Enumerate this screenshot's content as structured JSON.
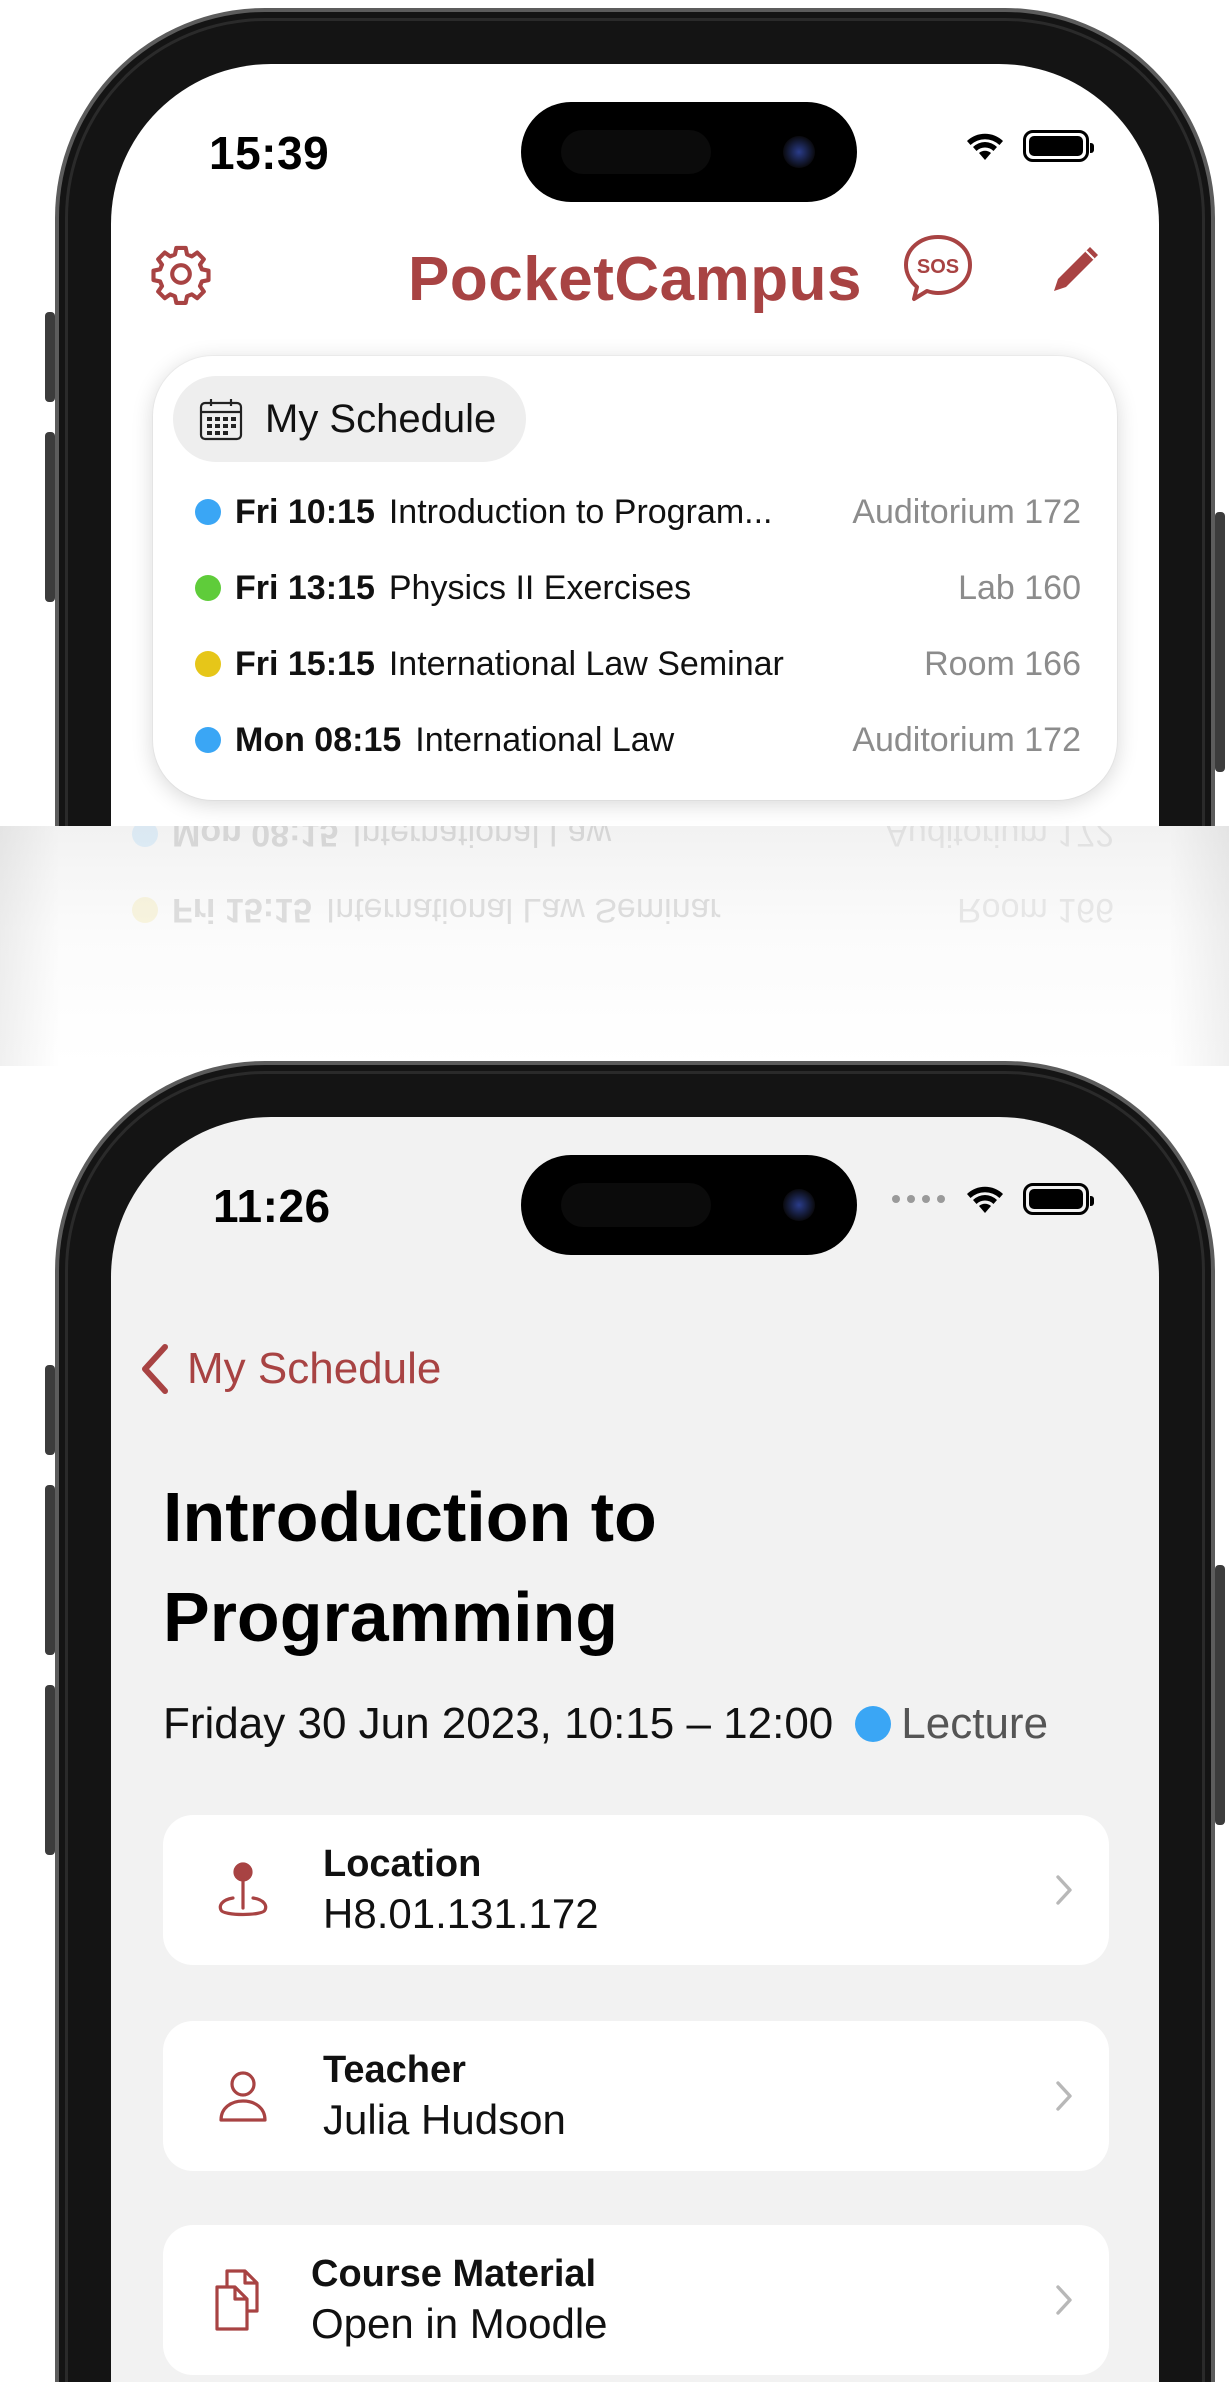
{
  "colors": {
    "brand": "#a84343",
    "lecture_blue": "#3aa6f5",
    "exercise_green": "#5fcc3a",
    "seminar_yellow": "#e6c619",
    "secondary_text": "#8c8c8c"
  },
  "phone1": {
    "status_time": "15:39",
    "app_title": "PocketCampus",
    "icons": [
      "gear-icon",
      "sos-icon",
      "pencil-icon"
    ],
    "widget": {
      "chip_label": "My Schedule",
      "chip_icon": "calendar-icon",
      "rows": [
        {
          "dot": "#3aa6f5",
          "when": "Fri 10:15",
          "title": "Introduction to Program...",
          "room": "Auditorium 172"
        },
        {
          "dot": "#5fcc3a",
          "when": "Fri 13:15",
          "title": "Physics II Exercises",
          "room": "Lab 160"
        },
        {
          "dot": "#e6c619",
          "when": "Fri 15:15",
          "title": "International Law Seminar",
          "room": "Room 166"
        },
        {
          "dot": "#3aa6f5",
          "when": "Mon 08:15",
          "title": "International Law",
          "room": "Auditorium 172"
        }
      ]
    }
  },
  "phone2": {
    "status_time": "11:26",
    "back_label": "My Schedule",
    "event_title": "Introduction to Programming",
    "event_when": "Friday 30 Jun 2023, 10:15 – 12:00",
    "event_type": "Lecture",
    "event_type_color": "#3aa6f5",
    "cards": [
      {
        "key": "Location",
        "value": "H8.01.131.172",
        "icon": "map-pin-icon"
      },
      {
        "key": "Teacher",
        "value": "Julia Hudson",
        "icon": "person-icon"
      },
      {
        "key": "Course Material",
        "value": "Open in Moodle",
        "icon": "documents-icon"
      }
    ]
  }
}
